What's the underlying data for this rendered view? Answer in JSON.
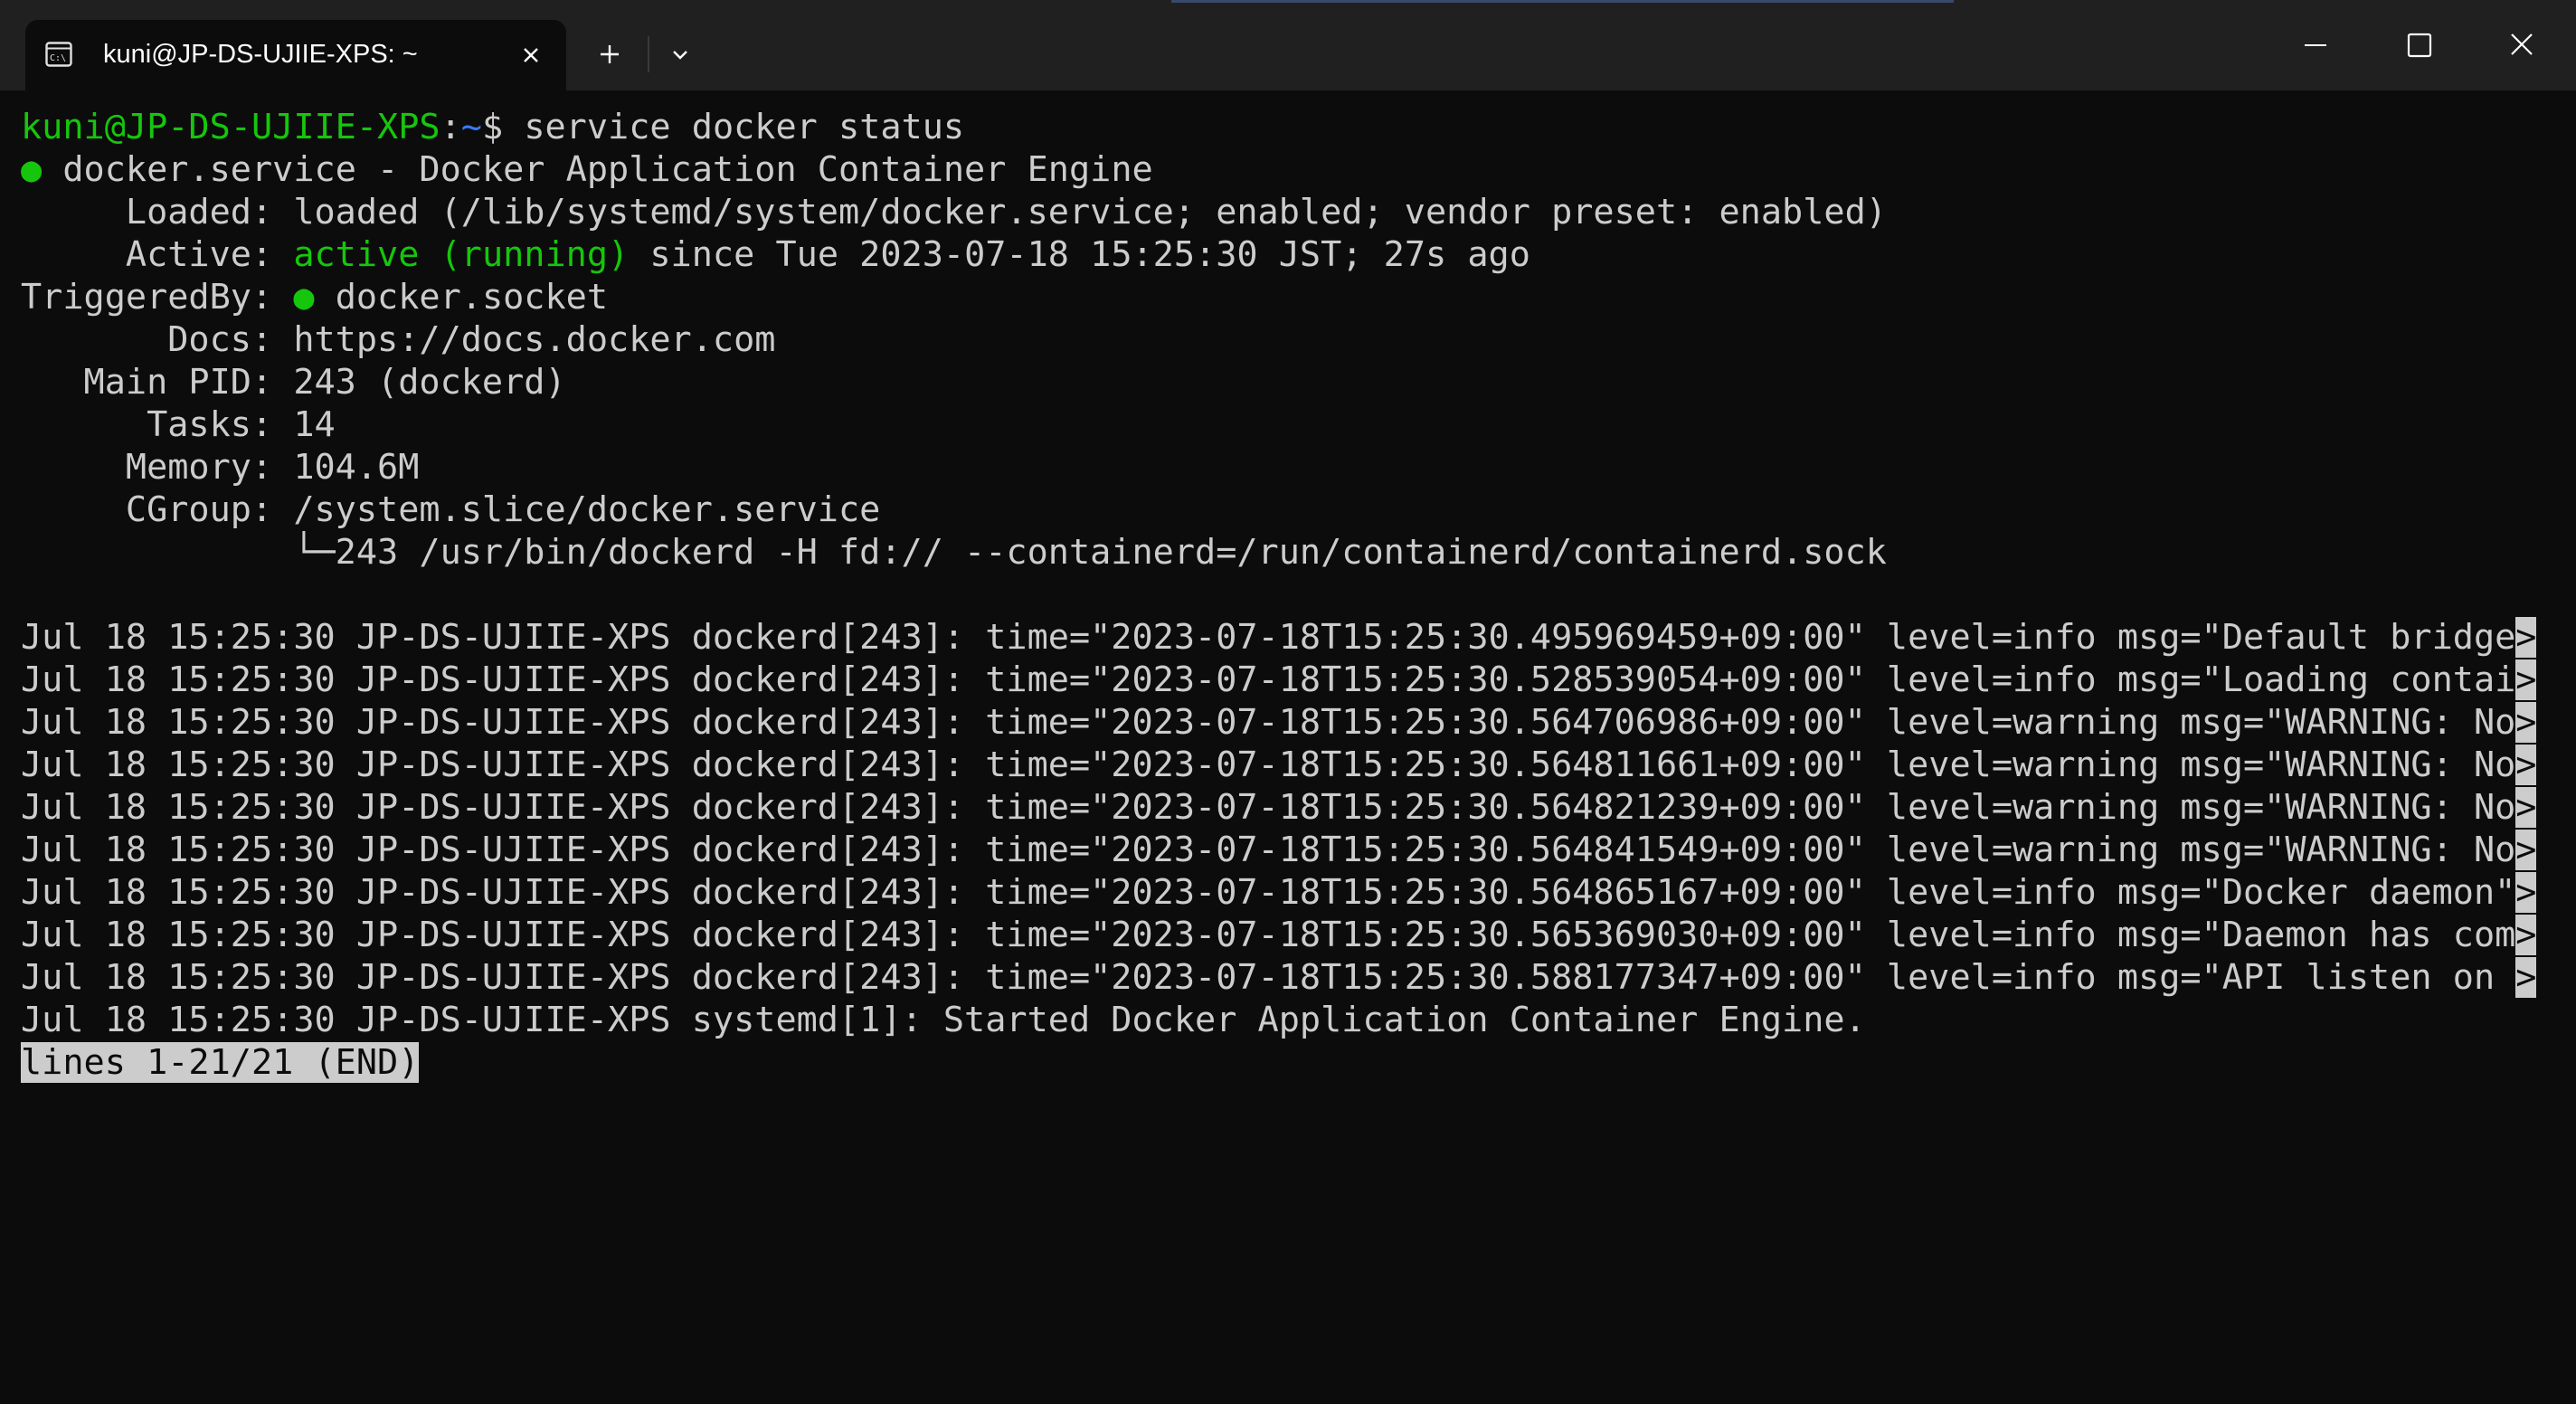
{
  "window": {
    "tab_title": "kuni@JP-DS-UJIIE-XPS: ~"
  },
  "terminal": {
    "prompt_user": "kuni@JP-DS-UJIIE-XPS",
    "prompt_sep": ":",
    "prompt_path": "~",
    "prompt_symbol": "$ ",
    "command": "service docker status",
    "service_bullet": "●",
    "service_line": " docker.service - Docker Application Container Engine",
    "loaded_line": "     Loaded: loaded (/lib/systemd/system/docker.service; enabled; vendor preset: enabled)",
    "active_label": "     Active: ",
    "active_status": "active (running)",
    "active_rest": " since Tue 2023-07-18 15:25:30 JST; 27s ago",
    "triggered_label": "TriggeredBy: ",
    "triggered_bullet": "●",
    "triggered_rest": " docker.socket",
    "docs_line": "       Docs: https://docs.docker.com",
    "pid_line": "   Main PID: 243 (dockerd)",
    "tasks_line": "      Tasks: 14",
    "memory_line": "     Memory: 104.6M",
    "cgroup_line": "     CGroup: /system.slice/docker.service",
    "cgroup_tree_line": "             └─243 /usr/bin/dockerd -H fd:// --containerd=/run/containerd/containerd.sock",
    "log_lines": [
      "Jul 18 15:25:30 JP-DS-UJIIE-XPS dockerd[243]: time=\"2023-07-18T15:25:30.495969459+09:00\" level=info msg=\"Default bridge",
      "Jul 18 15:25:30 JP-DS-UJIIE-XPS dockerd[243]: time=\"2023-07-18T15:25:30.528539054+09:00\" level=info msg=\"Loading contai",
      "Jul 18 15:25:30 JP-DS-UJIIE-XPS dockerd[243]: time=\"2023-07-18T15:25:30.564706986+09:00\" level=warning msg=\"WARNING: No",
      "Jul 18 15:25:30 JP-DS-UJIIE-XPS dockerd[243]: time=\"2023-07-18T15:25:30.564811661+09:00\" level=warning msg=\"WARNING: No",
      "Jul 18 15:25:30 JP-DS-UJIIE-XPS dockerd[243]: time=\"2023-07-18T15:25:30.564821239+09:00\" level=warning msg=\"WARNING: No",
      "Jul 18 15:25:30 JP-DS-UJIIE-XPS dockerd[243]: time=\"2023-07-18T15:25:30.564841549+09:00\" level=warning msg=\"WARNING: No",
      "Jul 18 15:25:30 JP-DS-UJIIE-XPS dockerd[243]: time=\"2023-07-18T15:25:30.564865167+09:00\" level=info msg=\"Docker daemon\"",
      "Jul 18 15:25:30 JP-DS-UJIIE-XPS dockerd[243]: time=\"2023-07-18T15:25:30.565369030+09:00\" level=info msg=\"Daemon has com",
      "Jul 18 15:25:30 JP-DS-UJIIE-XPS dockerd[243]: time=\"2023-07-18T15:25:30.588177347+09:00\" level=info msg=\"API listen on "
    ],
    "truncation_marker": ">",
    "final_log_line": "Jul 18 15:25:30 JP-DS-UJIIE-XPS systemd[1]: Started Docker Application Container Engine.",
    "pager_status": "lines 1-21/21 (END)"
  },
  "colors": {
    "background": "#0c0c0c",
    "foreground": "#cccccc",
    "green": "#16c60c",
    "blue": "#3b78ff",
    "titlebar": "#202020"
  },
  "icons": {
    "tab": "terminal-icon",
    "close_tab": "close-icon",
    "new_tab": "plus-icon",
    "dropdown": "chevron-down-icon",
    "minimize": "minimize-icon",
    "maximize": "maximize-icon",
    "close_window": "close-icon"
  }
}
